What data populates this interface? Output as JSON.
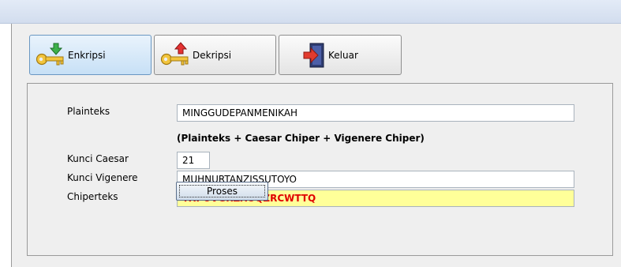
{
  "toolbar": {
    "enkripsi_label": "Enkripsi",
    "dekripsi_label": "Dekripsi",
    "keluar_label": "Keluar"
  },
  "form": {
    "plainteks_label": "Plainteks",
    "plainteks_value": "MINGGUDEPANMENIKAH",
    "note": "(Plainteks + Caesar Chiper + Vigenere Chiper)",
    "kunci_caesar_label": "Kunci Caesar",
    "kunci_caesar_value": "21",
    "kunci_vigenere_label": "Kunci Vigenere",
    "kunci_vigenere_value": "MUHNURTANZISSUTOYO",
    "chiperteks_label": "Chiperteks",
    "chiperteks_value": "TXPOVGRZXUQZRCWTTQ",
    "proses_label": "Proses"
  },
  "icons": {
    "enkripsi": "key-green-arrow-icon",
    "dekripsi": "key-red-arrow-icon",
    "keluar": "exit-door-icon"
  },
  "colors": {
    "result_background": "#ffff99",
    "result_text": "#e00000",
    "active_tab": "#c7e0f6"
  }
}
